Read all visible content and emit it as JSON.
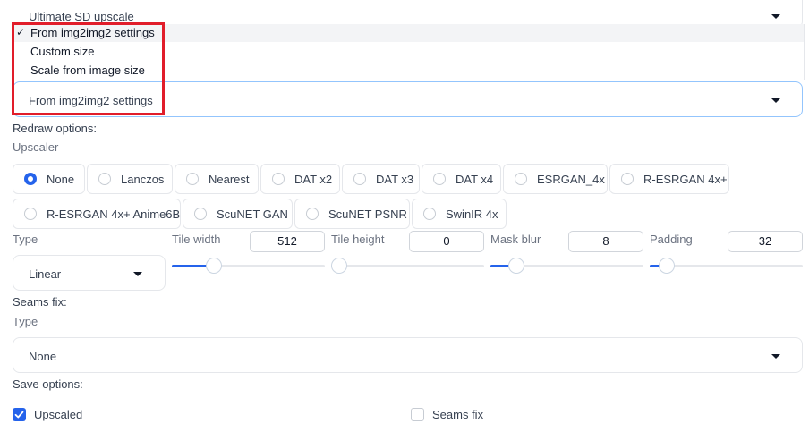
{
  "upscale_select": {
    "value": "Ultimate SD upscale"
  },
  "target_size": {
    "options": [
      {
        "label": "From img2img2 settings",
        "checked": true
      },
      {
        "label": "Custom size",
        "checked": false
      },
      {
        "label": "Scale from image size",
        "checked": false
      }
    ],
    "check_mark": "✓",
    "value": "From img2img2 settings"
  },
  "redraw": {
    "section_label": "Redraw options:",
    "upscaler_label": "Upscaler",
    "upscalers": [
      {
        "label": "None",
        "selected": true
      },
      {
        "label": "Lanczos",
        "selected": false
      },
      {
        "label": "Nearest",
        "selected": false
      },
      {
        "label": "DAT x2",
        "selected": false
      },
      {
        "label": "DAT x3",
        "selected": false
      },
      {
        "label": "DAT x4",
        "selected": false
      },
      {
        "label": "ESRGAN_4x",
        "selected": false
      },
      {
        "label": "R-ESRGAN 4x+",
        "selected": false
      },
      {
        "label": "R-ESRGAN 4x+ Anime6B",
        "selected": false
      },
      {
        "label": "ScuNET GAN",
        "selected": false
      },
      {
        "label": "ScuNET PSNR",
        "selected": false
      },
      {
        "label": "SwinIR 4x",
        "selected": false
      }
    ],
    "type_label": "Type",
    "type_value": "Linear",
    "sliders": [
      {
        "label": "Tile width",
        "value": "512"
      },
      {
        "label": "Tile height",
        "value": "0"
      },
      {
        "label": "Mask blur",
        "value": "8"
      },
      {
        "label": "Padding",
        "value": "32"
      }
    ]
  },
  "seams": {
    "section_label": "Seams fix:",
    "type_label": "Type",
    "type_value": "None"
  },
  "save": {
    "section_label": "Save options:",
    "upscaled": {
      "label": "Upscaled",
      "checked": true
    },
    "seams_fix": {
      "label": "Seams fix",
      "checked": false
    }
  },
  "highlight_color": "#e11d2a",
  "accent_color": "#2563eb"
}
